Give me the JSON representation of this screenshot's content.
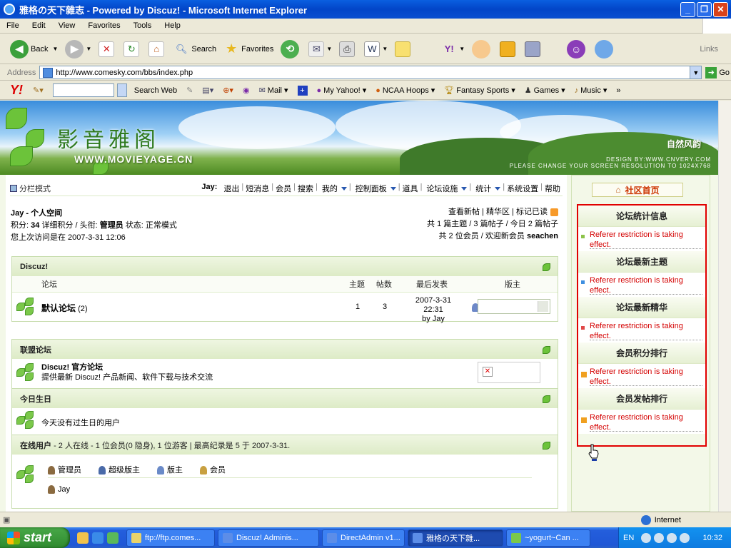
{
  "window": {
    "title": "雅格の天下雜志 - Powered by Discuz! - Microsoft Internet Explorer",
    "menu": [
      "File",
      "Edit",
      "View",
      "Favorites",
      "Tools",
      "Help"
    ]
  },
  "toolbar": {
    "back": "Back",
    "search": "Search",
    "favorites": "Favorites",
    "links": "Links"
  },
  "address": {
    "label": "Address",
    "url": "http://www.comesky.com/bbs/index.php",
    "go": "Go"
  },
  "yahoo": {
    "logo": "Y!",
    "search_web": "Search Web",
    "mail": "Mail",
    "my_yahoo": "My Yahoo!",
    "ncaa": "NCAA Hoops",
    "fantasy": "Fantasy Sports",
    "games": "Games",
    "music": "Music"
  },
  "banner": {
    "title": "影音雅阁",
    "site": "WWW.MOVIEYAGE.CN",
    "badge": "自然风韵",
    "design": "DESIGN BY:WWW.CNVERY.COM",
    "note": "PLEASE CHANGE YOUR SCREEN RESOLUTION TO 1024X768"
  },
  "nav": {
    "style": "分栏模式",
    "user": "Jay:",
    "links": [
      "退出",
      "短消息",
      "会员",
      "搜索",
      "我的",
      "控制面板",
      "道具",
      "论坛设施",
      "统计",
      "系统设置",
      "帮助"
    ]
  },
  "userinfo": {
    "space": "Jay - 个人空间",
    "line2_a": "积分:",
    "points": "34",
    "line2_b": "详细积分 / 头衔:",
    "rank": "管理员",
    "line2_c": "状态: 正常模式",
    "last_visit": "您上次访问是在 2007-3-31 12:06"
  },
  "rightinfo": {
    "links": "查看新帖 | 精华区 | 标记已读",
    "stats": "共 1 篇主题 / 3 篇帖子 / 今日 2 篇帖子",
    "members_a": "共 2 位会员 / 欢迎新会员",
    "newest": "seachen"
  },
  "forum": {
    "category": "Discuz!",
    "cols": {
      "forum": "论坛",
      "topics": "主题",
      "posts": "帖数",
      "last": "最后发表",
      "mods": "版主"
    },
    "row": {
      "name": "默认论坛",
      "count": "(2)",
      "topics": "1",
      "posts": "3",
      "last_time": "2007-3-31 22:31",
      "last_by": "by Jay"
    }
  },
  "alliance": {
    "title": "联盟论坛",
    "name": "Discuz! 官方论坛",
    "desc": "提供最新 Discuz! 产品新闻、软件下载与技术交流"
  },
  "birthday": {
    "title": "今日生日",
    "text": "今天没有过生日的用户"
  },
  "online": {
    "title": "在线用户",
    "summary": "- 2 人在线 - 1 位会员(0 隐身), 1 位游客 | 最高纪录是 5 于 2007-3-31.",
    "legend": [
      "管理员",
      "超级版主",
      "版主",
      "会员"
    ],
    "users": [
      "Jay"
    ]
  },
  "sidebar": {
    "home": "社区首页",
    "sections": [
      {
        "title": "论坛统计信息",
        "msg": "Referer restriction is taking effect.",
        "color": "#8CC34A"
      },
      {
        "title": "论坛最新主题",
        "msg": "Referer restriction is taking effect.",
        "color": "#3E8FE0"
      },
      {
        "title": "论坛最新精华",
        "msg": "Referer restriction is taking effect.",
        "color": "#E04848"
      },
      {
        "title": "会员积分排行",
        "msg": "Referer restriction is taking effect.",
        "color": "#F0A020"
      },
      {
        "title": "会员发帖排行",
        "msg": "Referer restriction is taking effect.",
        "color": "#F0A020"
      }
    ]
  },
  "status": {
    "zone": "Internet"
  },
  "taskbar": {
    "start": "start",
    "tasks": [
      "ftp://ftp.comes...",
      "Discuz! Adminis...",
      "DirectAdmin v1...",
      "雅格の天下雜...",
      "~yogurt~Can ..."
    ],
    "lang": "EN",
    "clock": "10:32"
  }
}
